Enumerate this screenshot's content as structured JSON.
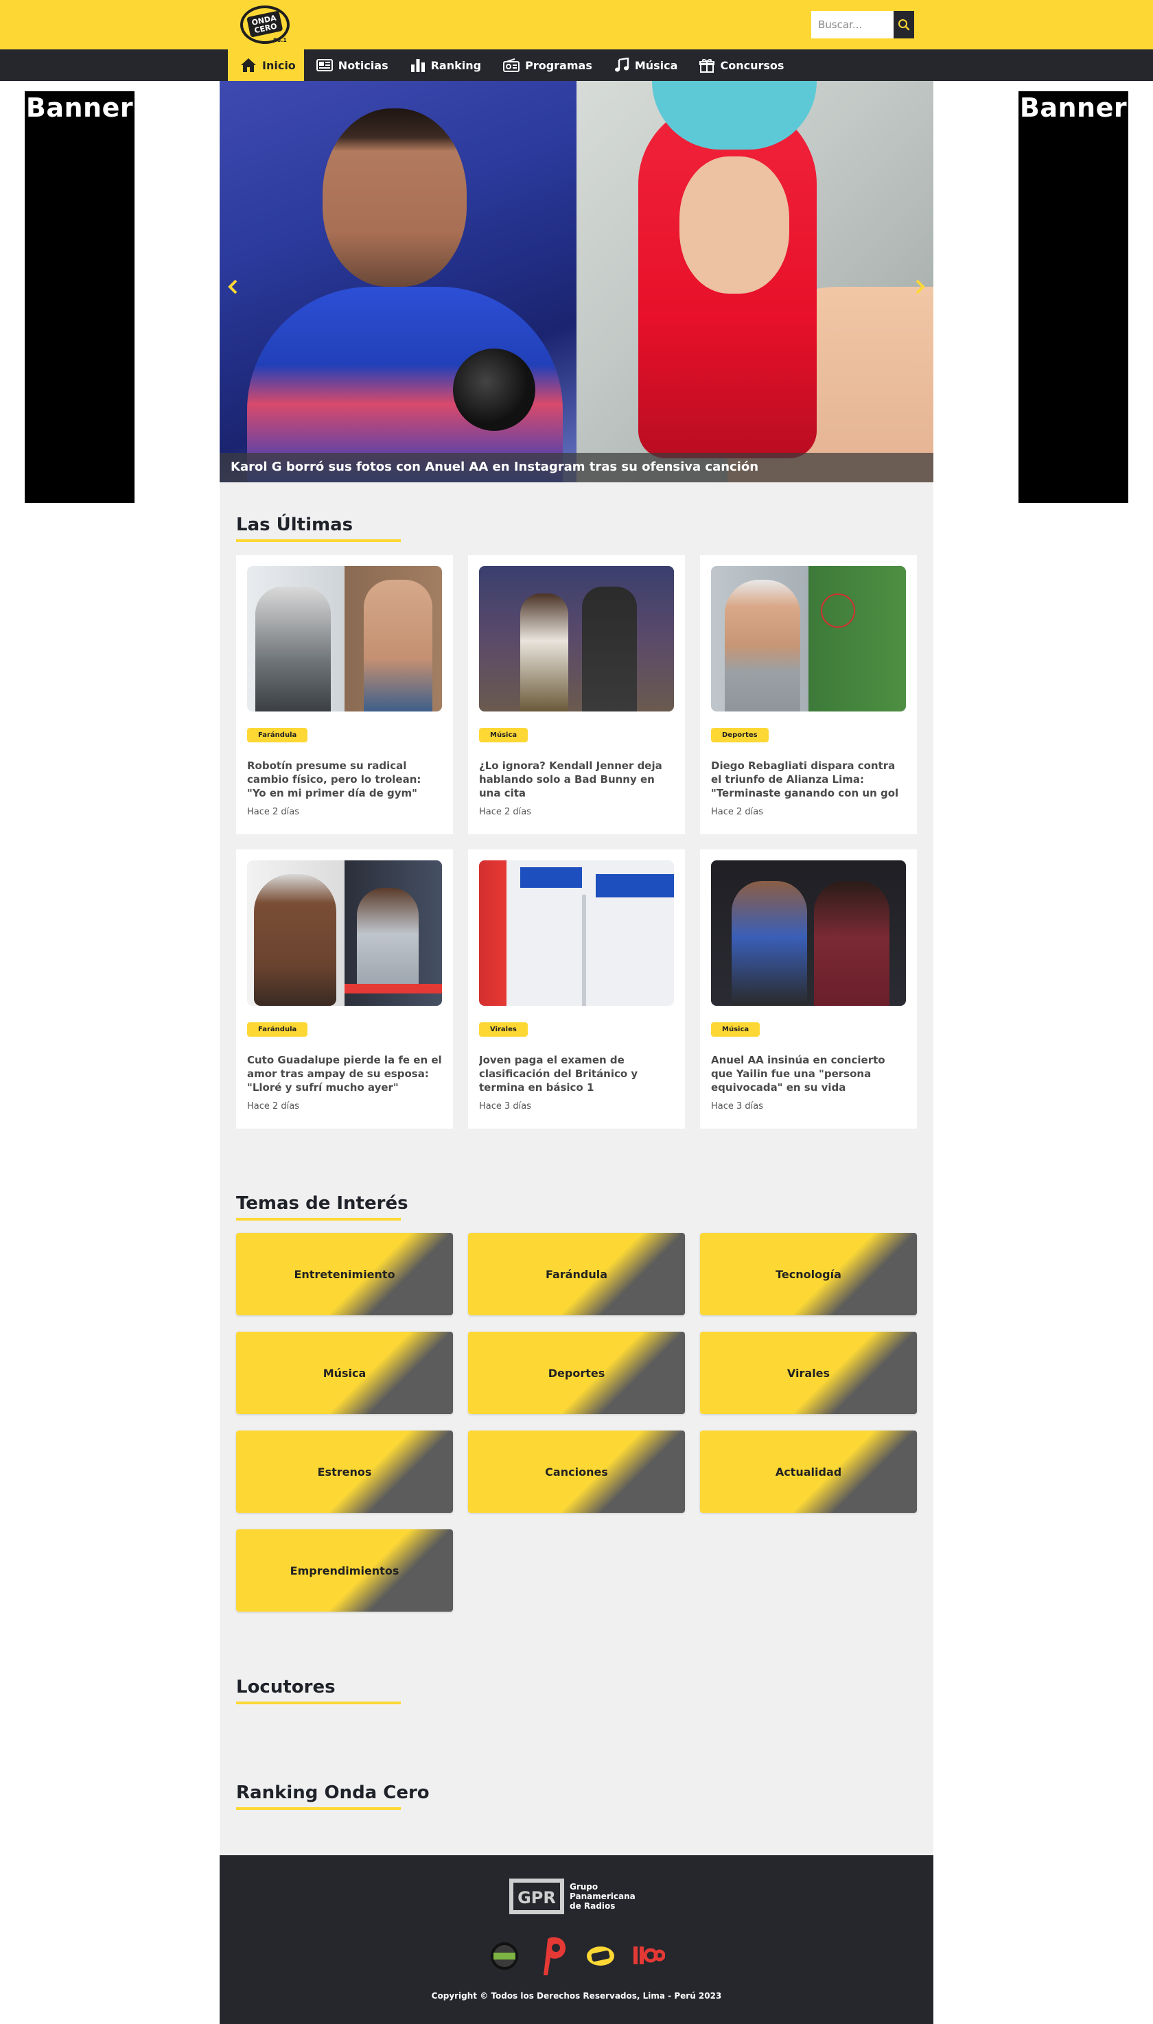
{
  "header": {
    "logo_alt": "Onda Cero",
    "logo_line1": "ONDA",
    "logo_line2": "CERO",
    "logo_freq": "98.1",
    "search": {
      "placeholder": "Buscar..."
    }
  },
  "nav": {
    "items": [
      {
        "label": "Inicio",
        "icon": "home-icon",
        "active": true
      },
      {
        "label": "Noticias",
        "icon": "newspaper-icon"
      },
      {
        "label": "Ranking",
        "icon": "bar-chart-icon"
      },
      {
        "label": "Programas",
        "icon": "radio-icon"
      },
      {
        "label": "Música",
        "icon": "music-note-icon"
      },
      {
        "label": "Concursos",
        "icon": "gift-icon"
      }
    ]
  },
  "banners": {
    "left": "Banner",
    "right": "Banner"
  },
  "hero": {
    "caption": "Karol G borró sus fotos con Anuel AA en Instagram tras su ofensiva canción"
  },
  "latest": {
    "title": "Las Últimas",
    "cards": [
      {
        "tag": "Farándula",
        "title": "Robotín presume su radical cambio físico, pero lo trolean: \"Yo en mi primer día de gym\"",
        "time": "Hace 2 días"
      },
      {
        "tag": "Música",
        "title": "¿Lo ignora? Kendall Jenner deja hablando solo a Bad Bunny en una cita",
        "time": "Hace 2 días"
      },
      {
        "tag": "Deportes",
        "title": "Diego Rebagliati dispara contra el triunfo de Alianza Lima: \"Terminaste ganando con un gol en offside\"",
        "time": "Hace 2 días"
      },
      {
        "tag": "Farándula",
        "title": "Cuto Guadalupe pierde la fe en el amor tras ampay de su esposa: \"Lloré y sufrí mucho ayer\"",
        "time": "Hace 2 días"
      },
      {
        "tag": "Virales",
        "title": "Joven paga el examen de clasificación del Británico y termina en básico 1",
        "time": "Hace 3 días"
      },
      {
        "tag": "Música",
        "title": "Anuel AA insinúa en concierto que Yailin fue una \"persona equivocada\" en su vida",
        "time": "Hace 3 días"
      }
    ]
  },
  "topics": {
    "title": "Temas de Interés",
    "items": [
      "Entretenimiento",
      "Farándula",
      "Tecnología",
      "Música",
      "Deportes",
      "Virales",
      "Estrenos",
      "Canciones",
      "Actualidad",
      "Emprendimientos"
    ]
  },
  "announcers": {
    "title": "Locutores"
  },
  "ranking": {
    "title": "Ranking Onda Cero"
  },
  "footer": {
    "group_line1": "Grupo",
    "group_line2": "Panamericana",
    "group_line3": "de Radios",
    "group_abbr": "GPR",
    "copyright": "Copyright © Todos los Derechos Reservados, Lima - Perú 2023"
  },
  "colors": {
    "accent": "#fdd835",
    "dark": "#25272d",
    "background": "#f0f0f0"
  }
}
